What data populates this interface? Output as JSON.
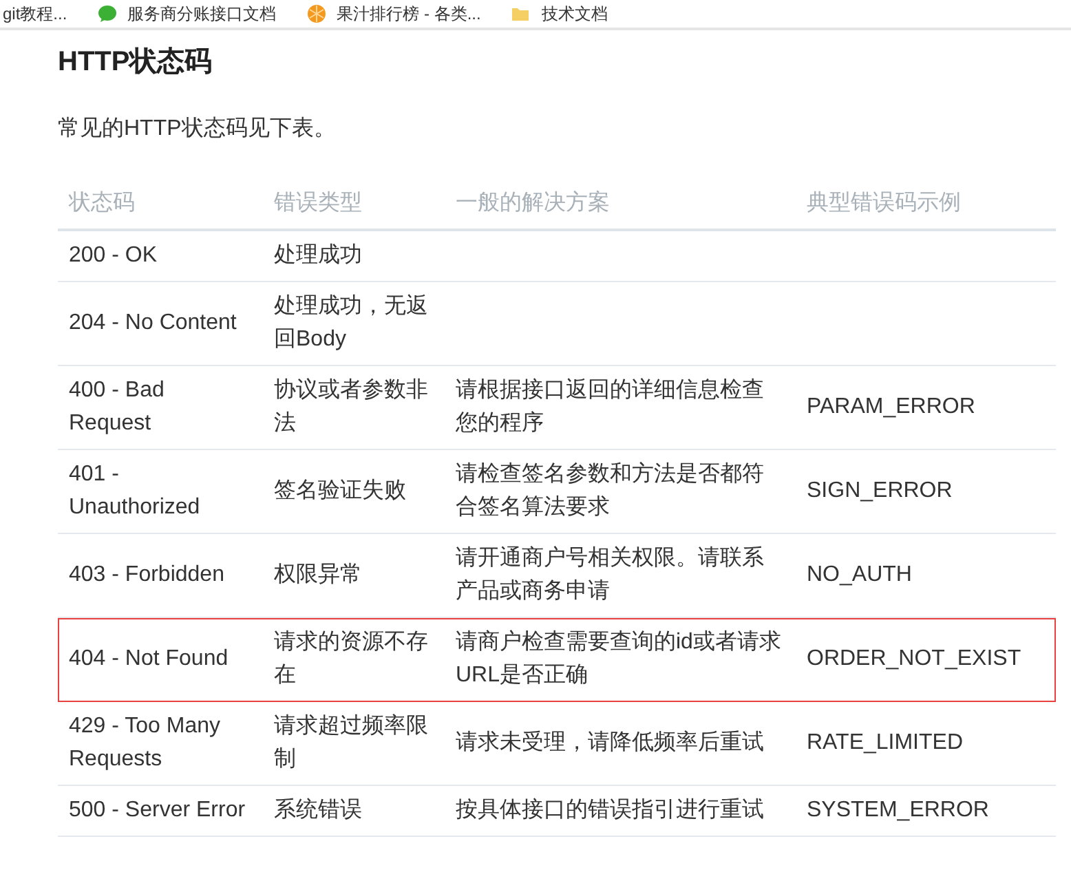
{
  "bookmarks": [
    {
      "label": "git教程...",
      "kind": "none"
    },
    {
      "label": "服务商分账接口文档",
      "kind": "chat"
    },
    {
      "label": "果汁排行榜 - 各类...",
      "kind": "pie"
    },
    {
      "label": "技术文档",
      "kind": "folder"
    }
  ],
  "title": "HTTP状态码",
  "intro": "常见的HTTP状态码见下表。",
  "table": {
    "columns": [
      "状态码",
      "错误类型",
      "一般的解决方案",
      "典型错误码示例"
    ],
    "rows": [
      {
        "cells": [
          "200 - OK",
          "处理成功",
          "",
          ""
        ],
        "highlighted": false
      },
      {
        "cells": [
          "204 - No Content",
          "处理成功，无返回Body",
          "",
          ""
        ],
        "highlighted": false
      },
      {
        "cells": [
          "400 - Bad Request",
          "协议或者参数非法",
          "请根据接口返回的详细信息检查您的程序",
          "PARAM_ERROR"
        ],
        "highlighted": false
      },
      {
        "cells": [
          "401 - Unauthorized",
          "签名验证失败",
          "请检查签名参数和方法是否都符合签名算法要求",
          "SIGN_ERROR"
        ],
        "highlighted": false
      },
      {
        "cells": [
          "403 - Forbidden",
          "权限异常",
          "请开通商户号相关权限。请联系产品或商务申请",
          "NO_AUTH"
        ],
        "highlighted": false
      },
      {
        "cells": [
          "404 - Not Found",
          "请求的资源不存在",
          "请商户检查需要查询的id或者请求URL是否正确",
          "ORDER_NOT_EXIST"
        ],
        "highlighted": true
      },
      {
        "cells": [
          "429 - Too Many Requests",
          "请求超过频率限制",
          "请求未受理，请降低频率后重试",
          "RATE_LIMITED"
        ],
        "highlighted": false
      },
      {
        "cells": [
          "500 - Server Error",
          "系统错误",
          "按具体接口的错误指引进行重试",
          "SYSTEM_ERROR"
        ],
        "highlighted": false
      }
    ]
  }
}
